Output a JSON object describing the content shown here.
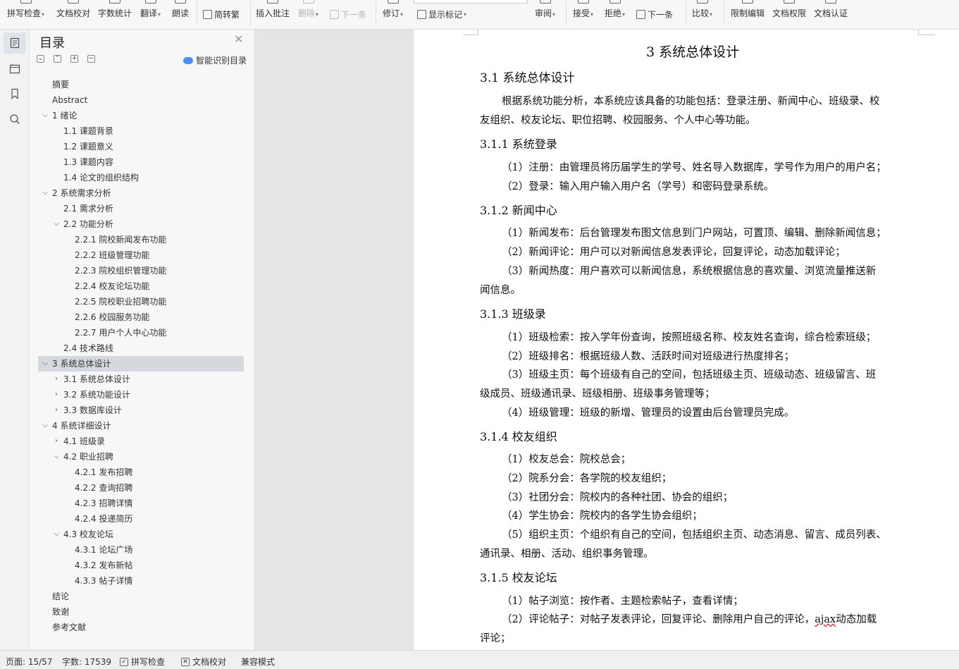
{
  "toolbar": {
    "spell_check": "拼写检查",
    "doc_proof": "文档校对",
    "word_count": "字数统计",
    "translate": "翻译",
    "read_aloud": "朗读",
    "convert": "简转繁",
    "insert_comment": "插入批注",
    "delete": "删除",
    "next_item": "下一条",
    "track_changes": "修订",
    "show_markup": "显示标记",
    "review": "审阅",
    "accept": "接受",
    "reject": "拒绝",
    "next_change": "下一条",
    "compare": "比较",
    "restrict_edit": "限制编辑",
    "doc_permission": "文档权限",
    "doc_certify": "文档认证"
  },
  "toc": {
    "title": "目录",
    "smart_button": "智能识别目录",
    "items": [
      {
        "label": "摘要",
        "level": 1,
        "state": "none"
      },
      {
        "label": "Abstract",
        "level": 1,
        "state": "none"
      },
      {
        "label": "1  绪论",
        "level": 1,
        "state": "expanded"
      },
      {
        "label": "1.1  课题背景",
        "level": 2,
        "state": "none"
      },
      {
        "label": "1.2  课题意义",
        "level": 2,
        "state": "none"
      },
      {
        "label": "1.3  课题内容",
        "level": 2,
        "state": "none"
      },
      {
        "label": "1.4  论文的组织结构",
        "level": 2,
        "state": "none"
      },
      {
        "label": "2  系统需求分析",
        "level": 1,
        "state": "expanded"
      },
      {
        "label": "2.1  需求分析",
        "level": 2,
        "state": "none"
      },
      {
        "label": "2.2  功能分析",
        "level": 2,
        "state": "expanded"
      },
      {
        "label": "2.2.1  院校新闻发布功能",
        "level": 3,
        "state": "none"
      },
      {
        "label": "2.2.2  班级管理功能",
        "level": 3,
        "state": "none"
      },
      {
        "label": "2.2.3  院校组织管理功能",
        "level": 3,
        "state": "none"
      },
      {
        "label": "2.2.4  校友论坛功能",
        "level": 3,
        "state": "none"
      },
      {
        "label": "2.2.5  院校职业招聘功能",
        "level": 3,
        "state": "none"
      },
      {
        "label": "2.2.6  校园服务功能",
        "level": 3,
        "state": "none"
      },
      {
        "label": "2.2.7  用户个人中心功能",
        "level": 3,
        "state": "none"
      },
      {
        "label": "2.4  技术路线",
        "level": 2,
        "state": "none"
      },
      {
        "label": "3  系统总体设计",
        "level": 1,
        "state": "expanded",
        "selected": true
      },
      {
        "label": "3.1  系统总体设计",
        "level": 2,
        "state": "collapsed"
      },
      {
        "label": "3.2  系统功能设计",
        "level": 2,
        "state": "collapsed"
      },
      {
        "label": "3.3  数据库设计",
        "level": 2,
        "state": "collapsed"
      },
      {
        "label": "4  系统详细设计",
        "level": 1,
        "state": "expanded"
      },
      {
        "label": "4.1  班级录",
        "level": 2,
        "state": "collapsed"
      },
      {
        "label": "4.2  职业招聘",
        "level": 2,
        "state": "expanded"
      },
      {
        "label": "4.2.1  发布招聘",
        "level": 3,
        "state": "none"
      },
      {
        "label": "4.2.2  查询招聘",
        "level": 3,
        "state": "none"
      },
      {
        "label": "4.2.3  招聘详情",
        "level": 3,
        "state": "none"
      },
      {
        "label": "4.2.4  投递简历",
        "level": 3,
        "state": "none"
      },
      {
        "label": "4.3  校友论坛",
        "level": 2,
        "state": "expanded"
      },
      {
        "label": "4.3.1  论坛广场",
        "level": 3,
        "state": "none"
      },
      {
        "label": "4.3.2  发布新帖",
        "level": 3,
        "state": "none"
      },
      {
        "label": "4.3.3  帖子详情",
        "level": 3,
        "state": "none"
      },
      {
        "label": "结论",
        "level": 1,
        "state": "none"
      },
      {
        "label": "致谢",
        "level": 1,
        "state": "none"
      },
      {
        "label": "参考文献",
        "level": 1,
        "state": "none"
      }
    ]
  },
  "document": {
    "lines": [
      {
        "kind": "h1",
        "text": "3  系统总体设计"
      },
      {
        "kind": "h2",
        "text": "3.1  系统总体设计"
      },
      {
        "kind": "p",
        "indent": true,
        "text": "根据系统功能分析，本系统应该具备的功能包括：登录注册、新闻中心、班级录、校"
      },
      {
        "kind": "p",
        "indent": false,
        "text": "友组织、校友论坛、职位招聘、校园服务、个人中心等功能。"
      },
      {
        "kind": "h3",
        "text": "3.1.1  系统登录"
      },
      {
        "kind": "p",
        "indent": true,
        "text": "（1）注册：由管理员将历届学生的学号、姓名导入数据库，学号作为用户的用户名；"
      },
      {
        "kind": "p",
        "indent": true,
        "text": "（2）登录：输入用户输入用户名（学号）和密码登录系统。"
      },
      {
        "kind": "h3",
        "text": "3.1.2  新闻中心"
      },
      {
        "kind": "p",
        "indent": true,
        "text": "（1）新闻发布：后台管理发布图文信息到门户网站，可置顶、编辑、删除新闻信息；"
      },
      {
        "kind": "p",
        "indent": true,
        "text": "（2）新闻评论：用户可以对新闻信息发表评论，回复评论，动态加载评论；"
      },
      {
        "kind": "p",
        "indent": true,
        "text": "（3）新闻热度：用户喜欢可以新闻信息，系统根据信息的喜欢量、浏览流量推送新"
      },
      {
        "kind": "p",
        "indent": false,
        "text": "闻信息。"
      },
      {
        "kind": "h3",
        "text": "3.1.3  班级录"
      },
      {
        "kind": "p",
        "indent": true,
        "text": "（1）班级检索：按入学年份查询，按照班级名称、校友姓名查询，综合检索班级；"
      },
      {
        "kind": "p",
        "indent": true,
        "text": "（2）班级排名：根据班级人数、活跃时间对班级进行热度排名；"
      },
      {
        "kind": "p",
        "indent": true,
        "text": "（3）班级主页：每个班级有自己的空间，包括班级主页、班级动态、班级留言、班"
      },
      {
        "kind": "p",
        "indent": false,
        "text": "级成员、班级通讯录、班级相册、班级事务管理等；"
      },
      {
        "kind": "p",
        "indent": true,
        "text": "（4）班级管理：班级的新增、管理员的设置由后台管理员完成。"
      },
      {
        "kind": "h3",
        "text": "3.1.4  校友组织"
      },
      {
        "kind": "p",
        "indent": true,
        "text": "（1）校友总会：院校总会；"
      },
      {
        "kind": "p",
        "indent": true,
        "text": "（2）院系分会：各学院的校友组织；"
      },
      {
        "kind": "p",
        "indent": true,
        "text": "（3）社团分会：院校内的各种社团、协会的组织；"
      },
      {
        "kind": "p",
        "indent": true,
        "text": "（4）学生协会：院校内的各学生协会组织；"
      },
      {
        "kind": "p",
        "indent": true,
        "text": "（5）组织主页：个组织有自己的空间，包括组织主页、动态消息、留言、成员列表、"
      },
      {
        "kind": "p",
        "indent": false,
        "text": "通讯录、相册、活动、组织事务管理。"
      },
      {
        "kind": "h3",
        "text": "3.1.5  校友论坛"
      },
      {
        "kind": "p",
        "indent": true,
        "text": "（1）帖子浏览：按作者、主题检索帖子，查看详情；"
      },
      {
        "kind": "p",
        "indent": true,
        "text": "（2）评论帖子：对帖子发表评论，回复评论、删除用户自己的评论，",
        "spell": "ajax",
        "tail": "动态加载"
      },
      {
        "kind": "p",
        "indent": false,
        "text": "评论；"
      }
    ]
  },
  "status": {
    "page": "页面: 15/57",
    "words": "字数: 17539",
    "spell_check": "拼写检查",
    "doc_proof": "文档校对",
    "compat_mode": "兼容模式"
  }
}
